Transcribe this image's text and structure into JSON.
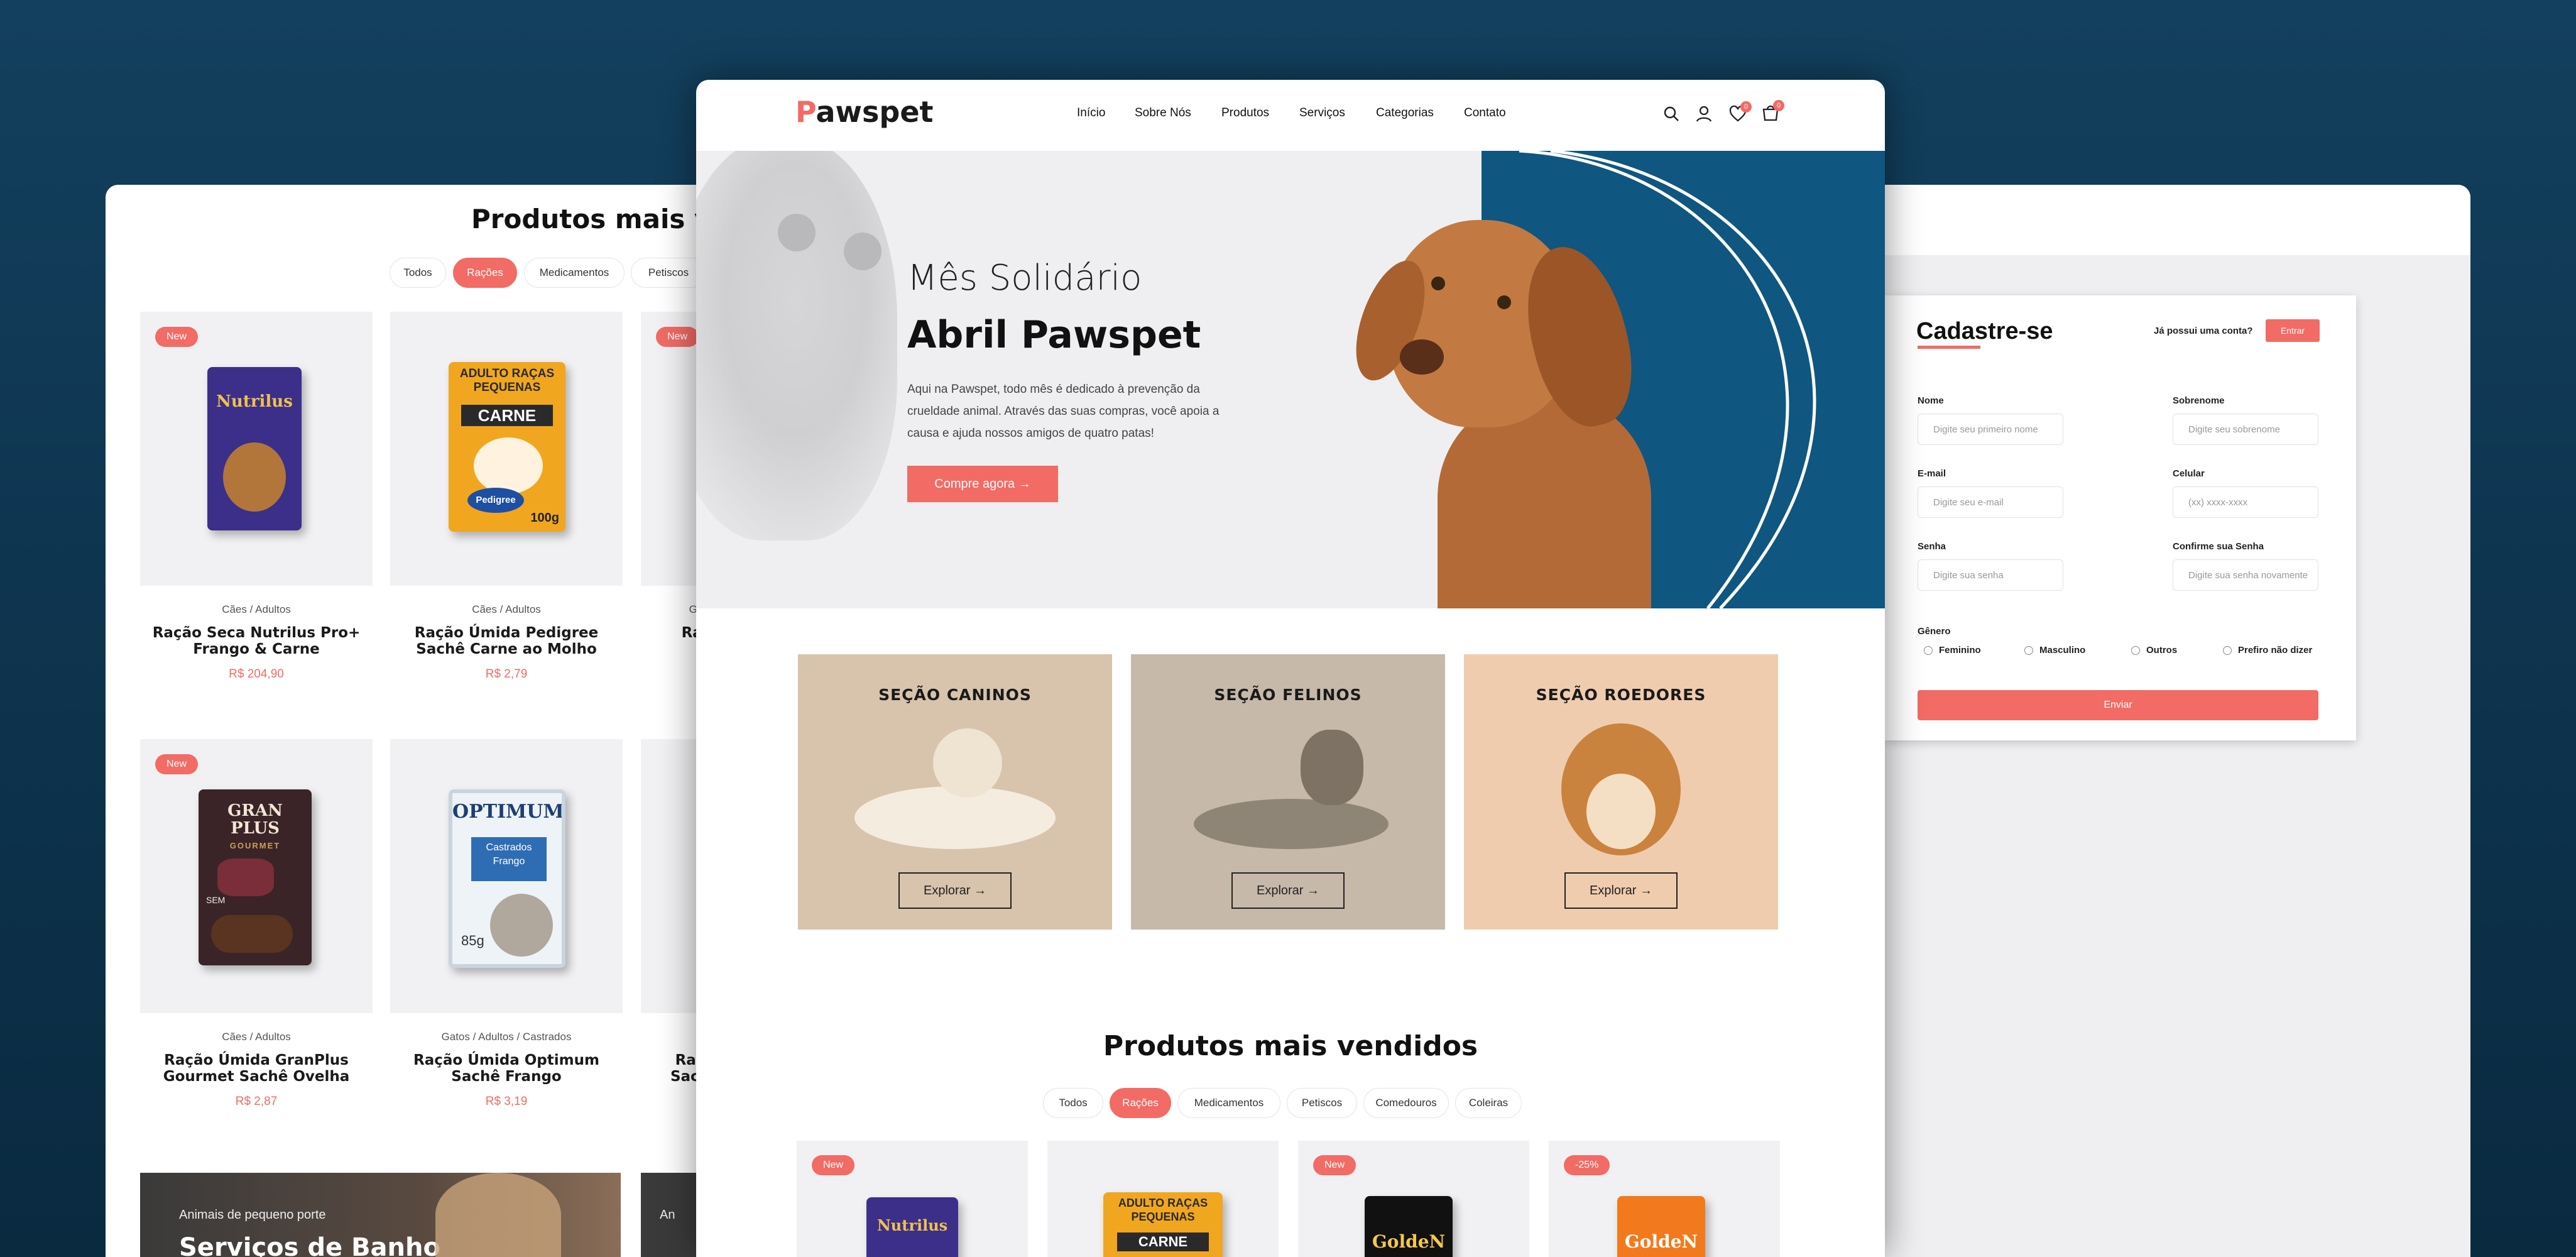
{
  "shop_back": {
    "section_title": "Produtos mais ve",
    "filters": [
      "Todos",
      "Rações",
      "Medicamentos",
      "Petiscos"
    ],
    "products": [
      {
        "badge": "New",
        "category": "Cães / Adultos",
        "name": "Ração Seca Nutrilus Pro+ Frango & Carne",
        "price": "R$ 204,90"
      },
      {
        "badge": "",
        "category": "Cães / Adultos",
        "name": "Ração Úmida Pedigree Sachê Carne ao Molho",
        "price": "R$ 2,79"
      },
      {
        "badge": "New",
        "category": "Ga",
        "name": "Raç",
        "price": ""
      },
      {
        "badge": "New",
        "category": "Cães / Adultos",
        "name": "Ração Úmida GranPlus Gourmet Sachê Ovelha",
        "price": "R$ 2,87"
      },
      {
        "badge": "",
        "category": "Gatos / Adultos / Castrados",
        "name": "Ração Úmida Optimum Sachê Frango",
        "price": "R$ 3,19"
      },
      {
        "badge": "",
        "category": "",
        "name": "Rac Sach",
        "price": ""
      }
    ],
    "banner": {
      "kicker": "Animais de pequeno porte",
      "title": "Serviços de Banho",
      "kicker2": "An"
    },
    "pkg": {
      "nutrilus": "Nutrilus",
      "pedigree_top": "ADULTO RAÇAS PEQUENAS",
      "pedigree_carne": "CARNE",
      "pedigree_brand": "Pedigree",
      "pedigree_weight": "100g",
      "granplus": "GRAN PLUS",
      "granplus_sub": "GOURMET",
      "granplus_sem": "SEM",
      "optimum": "OPTIMUM",
      "optimum_castrados": "Castrados",
      "optimum_frango": "Frango",
      "optimum_weight": "85g"
    }
  },
  "register": {
    "title": "Cadastre-se",
    "have_account": "Já possui uma conta?",
    "login_button": "Entrar",
    "fields": [
      {
        "label": "Nome",
        "placeholder": "Digite seu primeiro nome"
      },
      {
        "label": "Sobrenome",
        "placeholder": "Digite seu sobrenome"
      },
      {
        "label": "E-mail",
        "placeholder": "Digite seu e-mail"
      },
      {
        "label": "Celular",
        "placeholder": "(xx) xxxx-xxxx"
      },
      {
        "label": "Senha",
        "placeholder": "Digite sua senha"
      },
      {
        "label": "Confirme sua Senha",
        "placeholder": "Digite sua senha novamente"
      }
    ],
    "gender_label": "Gênero",
    "genders": [
      "Feminino",
      "Masculino",
      "Outros",
      "Prefiro não dizer"
    ],
    "submit": "Enviar"
  },
  "main": {
    "logo_initial": "P",
    "logo_rest": "awspet",
    "nav": [
      "Início",
      "Sobre Nós",
      "Produtos",
      "Serviços",
      "Categorias",
      "Contato"
    ],
    "wishlist_count": "0",
    "cart_count": "0",
    "hero": {
      "kicker": "Mês Solidário",
      "title": "Abril Pawspet",
      "text": "Aqui na Pawspet, todo mês é dedicado à prevenção da crueldade animal. Através das suas compras, você apoia a causa e ajuda nossos amigos de quatro patas!",
      "cta": "Compre agora →"
    },
    "categories": [
      {
        "title": "SEÇÃO CANINOS",
        "button": "Explorar →"
      },
      {
        "title": "SEÇÃO FELINOS",
        "button": "Explorar →"
      },
      {
        "title": "SEÇÃO ROEDORES",
        "button": "Explorar →"
      }
    ],
    "bestsellers_title": "Produtos mais vendidos",
    "filters": [
      "Todos",
      "Rações",
      "Medicamentos",
      "Petiscos",
      "Comedouros",
      "Coleiras"
    ],
    "bottom_badges": [
      "New",
      "",
      "New",
      "-25%"
    ],
    "bottom_pkgs": [
      "Nutrilus",
      "ADULTO RAÇAS PEQUENAS",
      "GoldeN",
      "GoldeN"
    ],
    "pedigree_carne": "CARNE"
  },
  "colors": {
    "accent": "#f26b65",
    "navy": "#0f5680",
    "background": "#0e3550"
  }
}
